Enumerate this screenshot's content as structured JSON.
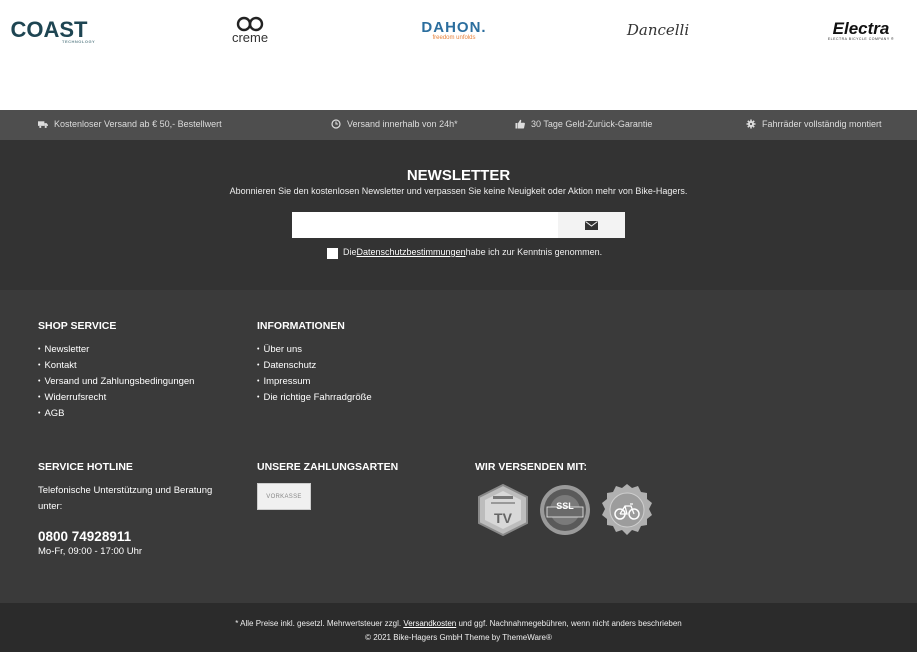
{
  "brands": [
    {
      "name": "COAST",
      "sub": "TECHNOLOGY"
    },
    {
      "name": "creme"
    },
    {
      "name": "DAHON.",
      "sub": "freedom unfolds"
    },
    {
      "name": "Dancelli"
    },
    {
      "name": "Electra",
      "sub": "ELECTRA BICYCLE COMPANY ®"
    }
  ],
  "usp": [
    {
      "icon": "truck-icon",
      "text": "Kostenloser Versand ab € 50,- Bestellwert"
    },
    {
      "icon": "clock-icon",
      "text": "Versand innerhalb von 24h*"
    },
    {
      "icon": "thumbs-up-icon",
      "text": "30 Tage Geld-Zurück-Garantie"
    },
    {
      "icon": "gear-icon",
      "text": "Fahrräder vollständig montiert"
    }
  ],
  "newsletter": {
    "title": "NEWSLETTER",
    "subtitle": "Abonnieren Sie den kostenlosen Newsletter und verpassen Sie keine Neuigkeit oder Aktion mehr von Bike-Hagers.",
    "email_value": "",
    "consent_before": "Die ",
    "consent_link": "Datenschutzbestimmungen",
    "consent_after": " habe ich zur Kenntnis genommen."
  },
  "footer": {
    "shop_service": {
      "title": "SHOP SERVICE",
      "items": [
        "Newsletter",
        "Kontakt",
        "Versand und Zahlungsbedingungen",
        "Widerrufsrecht",
        "AGB"
      ]
    },
    "informationen": {
      "title": "INFORMATIONEN",
      "items": [
        "Über uns",
        "Datenschutz",
        "Impressum",
        "Die richtige Fahrradgröße"
      ]
    },
    "hotline": {
      "title": "SERVICE HOTLINE",
      "text": "Telefonische Unterstützung und Beratung unter:",
      "phone": "0800 74928911",
      "hours": "Mo-Fr, 09:00 - 17:00 Uhr"
    },
    "payment": {
      "title": "UNSERE ZAHLUNGSARTEN",
      "methods": [
        "VORKASSE"
      ]
    },
    "shipping": {
      "title": "WIR VERSENDEN MIT:",
      "seal_tv": "TV",
      "seal_ssl": "SSL"
    }
  },
  "bottom": {
    "line1_before": "* Alle Preise inkl. gesetzl. Mehrwertsteuer zzgl. ",
    "line1_link": "Versandkosten",
    "line1_after": " und ggf. Nachnahmegebühren, wenn nicht anders beschrieben",
    "line2": "© 2021 Bike-Hagers GmbH Theme by ThemeWare®"
  },
  "colors": {
    "dark_bg": "#333333",
    "footer_bg": "#3a3a3a",
    "usp_bg": "#4e4e4e",
    "bottom_bg": "#2b2b2b"
  }
}
